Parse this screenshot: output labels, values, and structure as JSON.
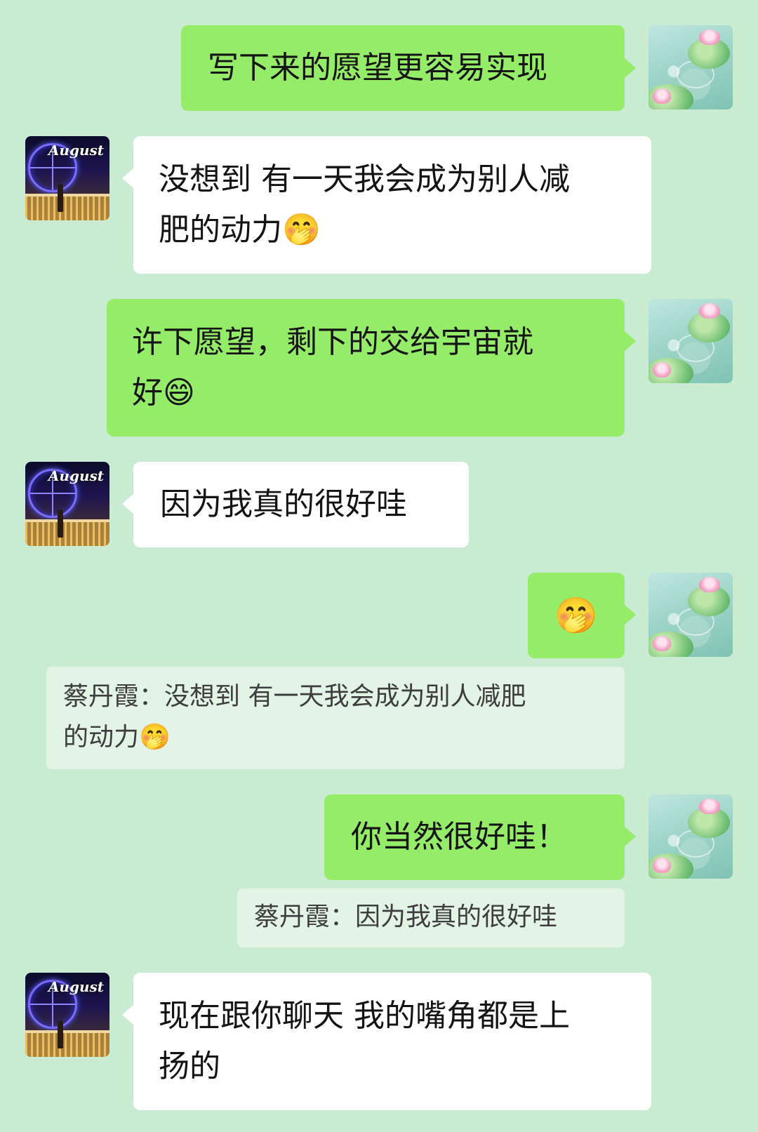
{
  "messages": [
    {
      "id": 1,
      "side": "me",
      "text": "写下来的愿望更容易实现"
    },
    {
      "id": 2,
      "side": "other",
      "line1": "没想到 有一天我会成为别人减",
      "line2": "肥的动力",
      "emoji": "🤭"
    },
    {
      "id": 3,
      "side": "me",
      "line1": "许下愿望，剩下的交给宇宙就",
      "line2": "好",
      "emoji": "😄"
    },
    {
      "id": 4,
      "side": "other",
      "text": "因为我真的很好哇"
    },
    {
      "id": 5,
      "side": "me",
      "emoji": "🤭"
    },
    {
      "id": 6,
      "side": "quote",
      "line1": "蔡丹霞：没想到 有一天我会成为别人减肥",
      "line2": "的动力",
      "emoji": "🤭"
    },
    {
      "id": 7,
      "side": "me",
      "text": "你当然很好哇！"
    },
    {
      "id": 8,
      "side": "quote",
      "text": "蔡丹霞：因为我真的很好哇"
    },
    {
      "id": 9,
      "side": "other",
      "line1": "现在跟你聊天 我的嘴角都是上",
      "line2": "扬的"
    }
  ],
  "avatars": {
    "other_label": "August"
  },
  "colors": {
    "background": "#c9ebd1",
    "my_bubble": "#95ec69",
    "other_bubble": "#ffffff",
    "quote_box": "#e3f3e6"
  }
}
